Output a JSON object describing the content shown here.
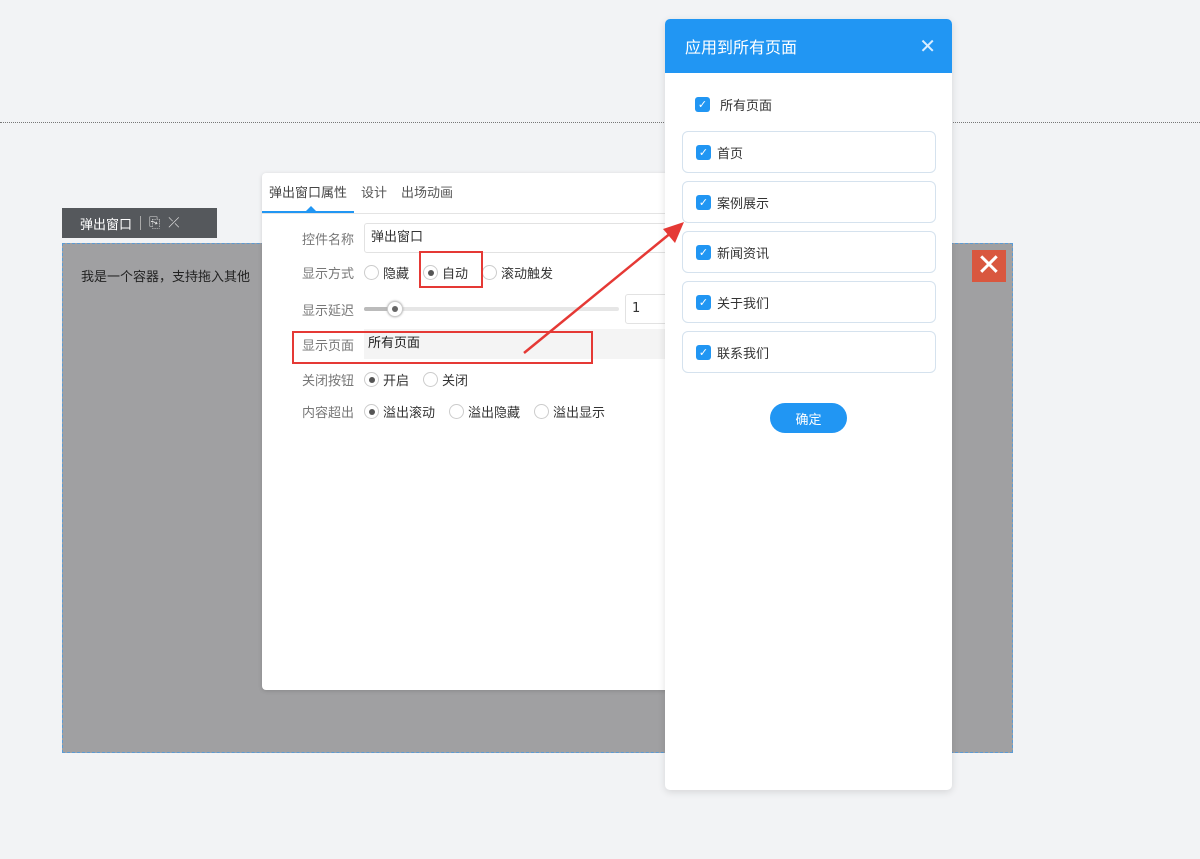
{
  "toolbar": {
    "label": "弹出窗口",
    "icons": [
      "settings-doc-icon",
      "unlink-icon"
    ]
  },
  "container": {
    "text": "我是一个容器，支持拖入其他"
  },
  "panel": {
    "tabs": [
      "弹出窗口属性",
      "设计",
      "出场动画"
    ],
    "name_label": "控件名称",
    "name_value": "弹出窗口",
    "display_mode_label": "显示方式",
    "display_modes": [
      "隐藏",
      "自动",
      "滚动触发"
    ],
    "delay_label": "显示延迟",
    "delay_value": "1",
    "delay_fraction": 0.12,
    "page_label": "显示页面",
    "page_value": "所有页面",
    "close_label": "关闭按钮",
    "close_options": [
      "开启",
      "关闭"
    ],
    "overflow_label": "内容超出",
    "overflow_options": [
      "溢出滚动",
      "溢出隐藏",
      "溢出显示"
    ]
  },
  "modal": {
    "title": "应用到所有页面",
    "close": "✕",
    "all_label": "所有页面",
    "pages": [
      "首页",
      "案例展示",
      "新闻资讯",
      "关于我们",
      "联系我们"
    ],
    "confirm": "确定"
  },
  "colors": {
    "accent": "#2196f3",
    "highlight": "#e53935",
    "close": "#d9573f"
  }
}
